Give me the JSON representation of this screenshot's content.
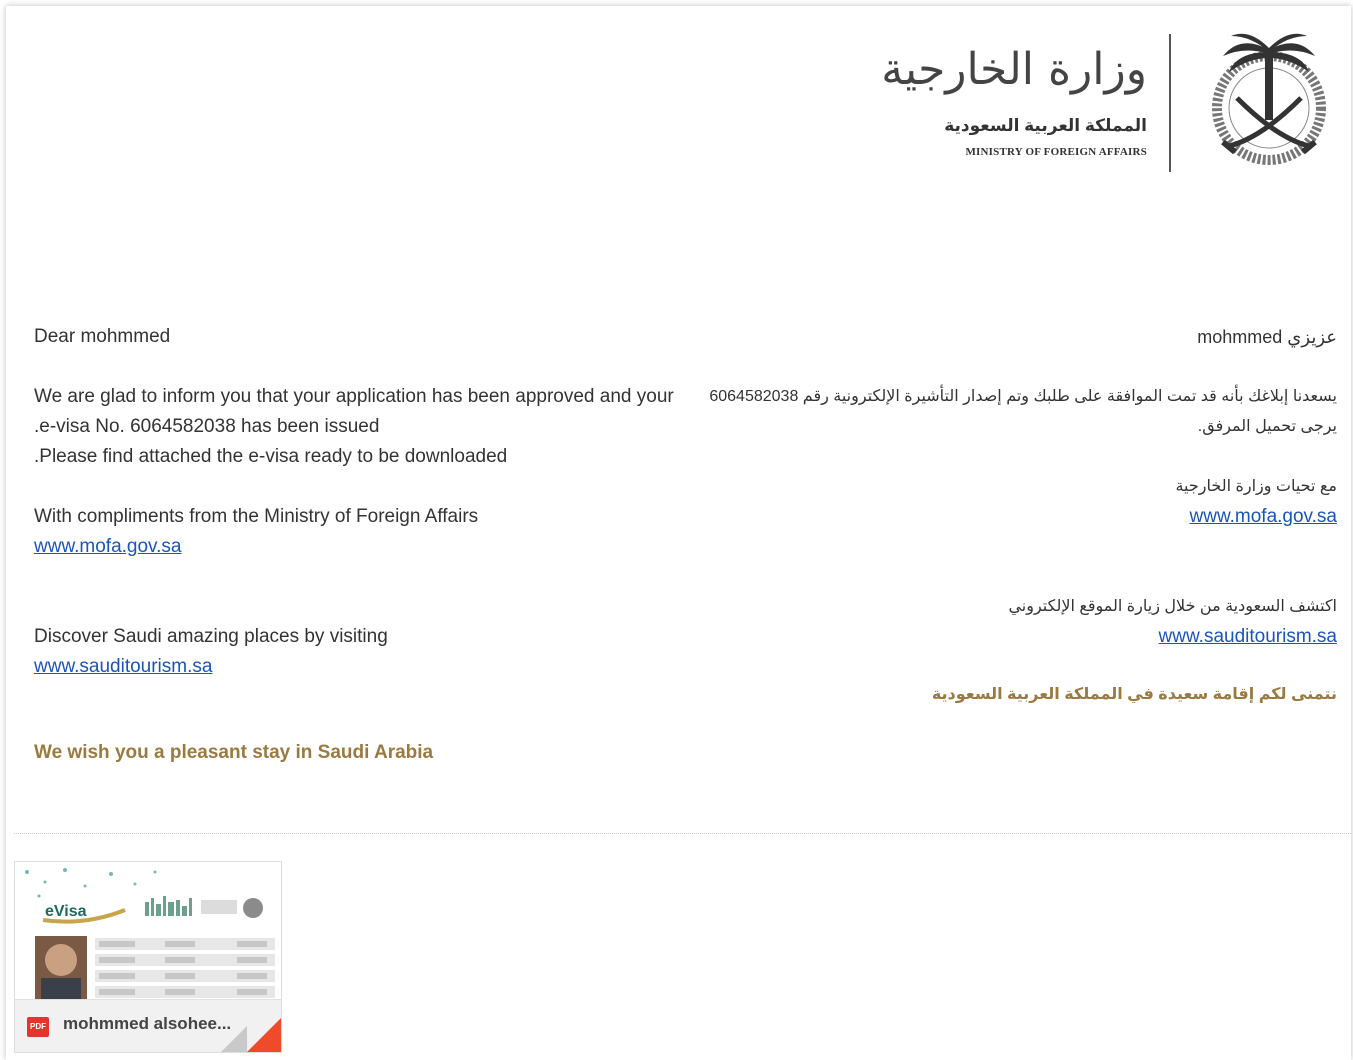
{
  "header": {
    "arabic_title": "وزارة الخارجية",
    "arabic_subtitle": "المملكة العربية السعودية",
    "english_subtitle": "MINISTRY OF FOREIGN AFFAIRS"
  },
  "english": {
    "greeting": "Dear mohmmed",
    "line1": "We are glad to inform you that your application has been approved and your",
    "line2": ".e-visa No. 6064582038 has been issued",
    "line3": ".Please find attached the e-visa ready to be downloaded",
    "compliments": "With compliments from the Ministry of Foreign Affairs",
    "mofa_link": "www.mofa.gov.sa",
    "discover": "Discover Saudi amazing places by visiting",
    "tourism_link": "www.sauditourism.sa",
    "wish": "We wish you a pleasant stay in Saudi Arabia"
  },
  "arabic": {
    "greeting": "عزيزي mohmmed",
    "line1": "يسعدنا إبلاغك بأنه قد تمت الموافقة على طلبك وتم إصدار التأشيرة الإلكترونية رقم 6064582038",
    "line2": "يرجى تحميل المرفق.",
    "compliments": "مع تحيات وزارة الخارجية",
    "mofa_link": "www.mofa.gov.sa",
    "discover": "اكتشف السعودية من خلال زيارة الموقع الإلكتروني",
    "tourism_link": "www.sauditourism.sa",
    "wish": "نتمنى لكم إقامة سعيدة في المملكة العربية السعودية"
  },
  "attachment": {
    "type_badge": "PDF",
    "filename": "mohmmed alsohee..."
  }
}
